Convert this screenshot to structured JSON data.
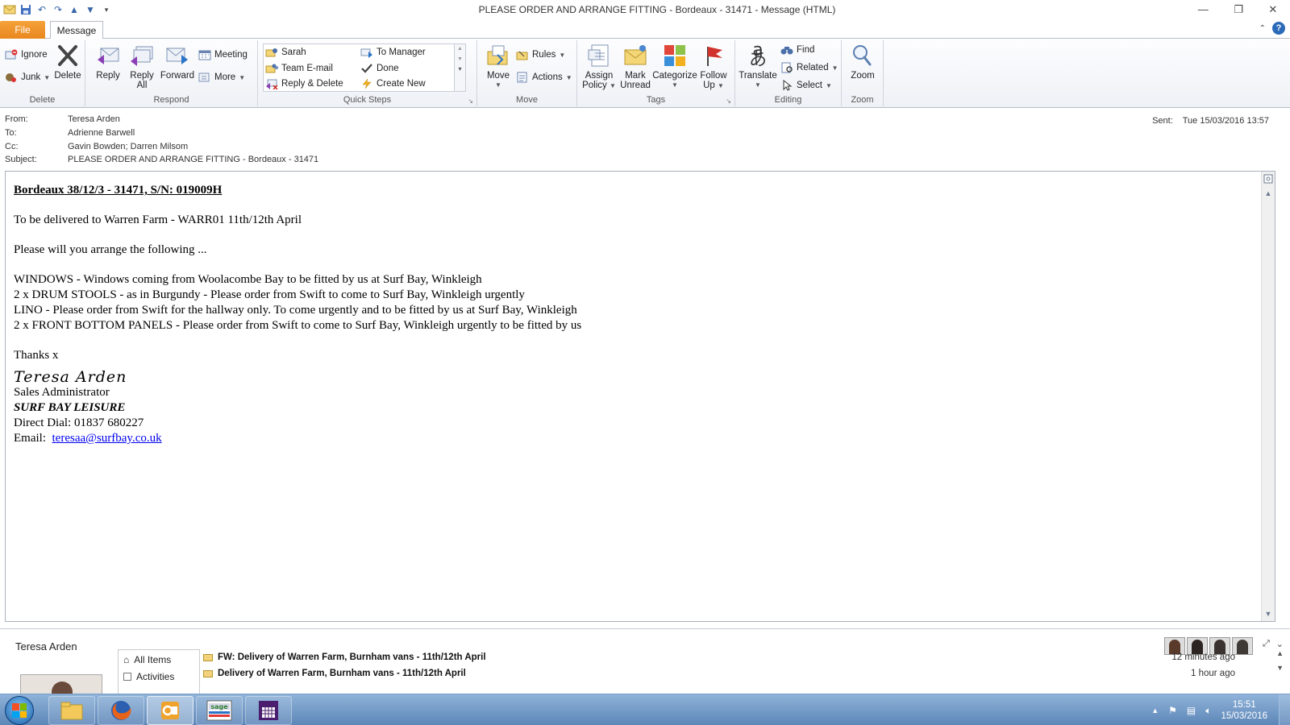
{
  "window": {
    "title": "PLEASE ORDER AND ARRANGE FITTING - Bordeaux - 31471  -  Message (HTML)",
    "minimize": "—",
    "restore": "❐",
    "close": "✕"
  },
  "tabs": {
    "file": "File",
    "message": "Message"
  },
  "ribbon": {
    "delete_group": {
      "label": "Delete",
      "ignore": "Ignore",
      "junk": "Junk",
      "delete": "Delete"
    },
    "respond_group": {
      "label": "Respond",
      "reply": "Reply",
      "reply_all_1": "Reply",
      "reply_all_2": "All",
      "forward": "Forward",
      "meeting": "Meeting",
      "more": "More"
    },
    "quick_steps_group": {
      "label": "Quick Steps",
      "items": [
        "Sarah",
        "Team E-mail",
        "Reply & Delete",
        "To Manager",
        "Done",
        "Create New"
      ]
    },
    "move_group": {
      "label": "Move",
      "move": "Move",
      "rules": "Rules",
      "actions": "Actions"
    },
    "tags_group": {
      "label": "Tags",
      "assign_1": "Assign",
      "assign_2": "Policy",
      "mark_1": "Mark",
      "mark_2": "Unread",
      "categorize": "Categorize",
      "follow_1": "Follow",
      "follow_2": "Up"
    },
    "editing_group": {
      "label": "Editing",
      "translate": "Translate",
      "find": "Find",
      "related": "Related",
      "select": "Select"
    },
    "zoom_group": {
      "label": "Zoom",
      "zoom": "Zoom"
    }
  },
  "headers": {
    "from_label": "From:",
    "from": "Teresa Arden",
    "to_label": "To:",
    "to": "Adrienne Barwell",
    "cc_label": "Cc:",
    "cc": "Gavin Bowden; Darren Milsom",
    "subject_label": "Subject:",
    "subject": "PLEASE ORDER AND ARRANGE FITTING - Bordeaux - 31471",
    "sent_label": "Sent:",
    "sent": "Tue 15/03/2016 13:57"
  },
  "body": {
    "heading": "Bordeaux 38/12/3 - 31471, S/N: 019009H",
    "delivery": "To be delivered to Warren Farm - WARR01 11th/12th April",
    "intro": "Please will you arrange the following ...",
    "items": [
      "WINDOWS - Windows coming from Woolacombe Bay to be fitted by us at Surf Bay, Winkleigh",
      "2 x DRUM STOOLS - as in Burgundy - Please order from Swift to come to Surf Bay, Winkleigh urgently",
      "LINO - Please order from Swift for the hallway only.  To come urgently and to be fitted by us at Surf Bay, Winkleigh",
      "2 x FRONT BOTTOM PANELS - Please order from Swift to come to Surf Bay, Winkleigh urgently to be fitted by us"
    ],
    "thanks": "Thanks x",
    "signature_script": "Teresa Arden",
    "role": "Sales Administrator",
    "company": "SURF BAY LEISURE",
    "direct_dial": "Direct Dial:  01837 680227",
    "email_label": "Email:",
    "email": "teresaa@surfbay.co.uk"
  },
  "people_pane": {
    "name": "Teresa Arden",
    "list": [
      "All Items",
      "Activities"
    ],
    "messages": [
      {
        "subject": "FW: Delivery of Warren Farm, Burnham vans - 11th/12th April",
        "time": "12 minutes ago"
      },
      {
        "subject": "Delivery of Warren Farm, Burnham vans - 11th/12th April",
        "time": "1 hour ago"
      }
    ]
  },
  "taskbar": {
    "time": "15:51",
    "date": "15/03/2016"
  }
}
